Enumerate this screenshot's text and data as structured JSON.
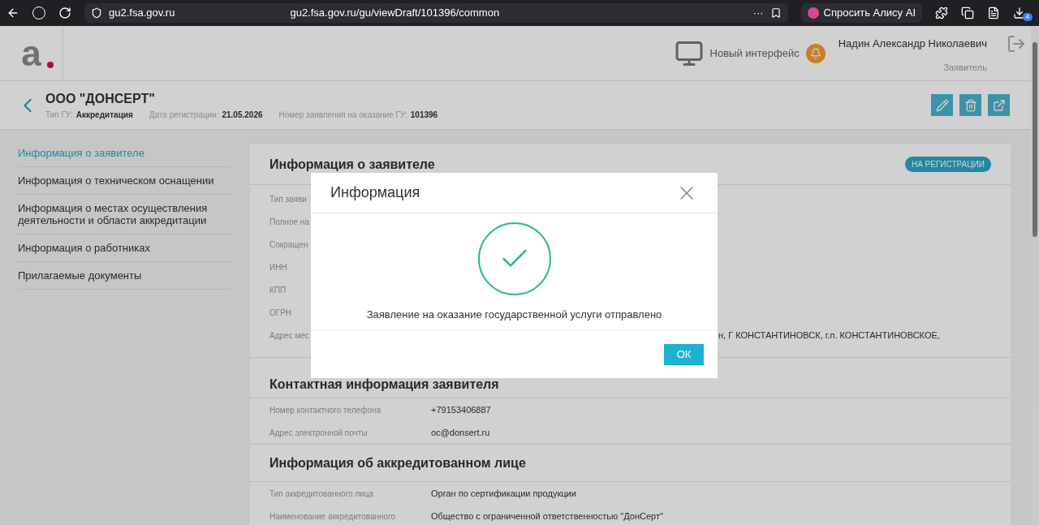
{
  "browser": {
    "site": "gu2.fsa.gov.ru",
    "url": "gu2.fsa.gov.ru/gu/viewDraft/101396/common",
    "more": "···",
    "alice": "Спросить Алису AI",
    "badge": "4"
  },
  "header": {
    "logo": "а",
    "new_ui": "Новый интерфейс",
    "user": "Надин Александр Николаевич",
    "role": "Заявитель"
  },
  "subheader": {
    "title": "ООО \"ДОНСЕРТ\"",
    "meta": [
      {
        "label": "Тип ГУ:",
        "value": "Аккредитация"
      },
      {
        "label": "Дата регистрации:",
        "value": "21.05.2026"
      },
      {
        "label": "Номер заявления на оказание ГУ:",
        "value": "101396"
      }
    ]
  },
  "sidebar": {
    "items": [
      {
        "label": "Информация о заявителе",
        "selected": true
      },
      {
        "label": "Информация о техническом оснащении",
        "selected": false
      },
      {
        "label": "Информация о местах осуществления деятельности и области аккредитации",
        "selected": false
      },
      {
        "label": "Информация о работниках",
        "selected": false
      },
      {
        "label": "Прилагаемые документы",
        "selected": false
      }
    ]
  },
  "sections": [
    {
      "title": "Информация о заявителе",
      "badge": "НА РЕГИСТРАЦИИ",
      "rows": [
        {
          "label": "Тип заяви"
        },
        {
          "label": "Полное на"
        },
        {
          "label": "Сокращен"
        },
        {
          "label": "ИНН"
        },
        {
          "label": "КПП"
        },
        {
          "label": "ОГРН"
        },
        {
          "label": "Адрес мес",
          "value": "н, Г КОНСТАНТИНОВСК, г.п. КОНСТАНТИНОВСКОЕ,"
        }
      ]
    },
    {
      "title": "Контактная информация заявителя",
      "rows": [
        {
          "label": "Номер контактного телефона",
          "value": "+79153406887"
        },
        {
          "label": "Адрес электронной почты",
          "value": "oc@donsert.ru"
        }
      ]
    },
    {
      "title": "Информация об аккредитованном лице",
      "rows": [
        {
          "label": "Тип аккредитованного лица",
          "value": "Орган по сертификации продукции"
        },
        {
          "label": "Наименование аккредитованного",
          "value": "Общество с ограниченной ответственностью \"ДонСерт\""
        }
      ]
    }
  ],
  "dialog": {
    "title": "Информация",
    "message": "Заявление на оказание государственной услуги отправлено",
    "button": "ОК"
  }
}
